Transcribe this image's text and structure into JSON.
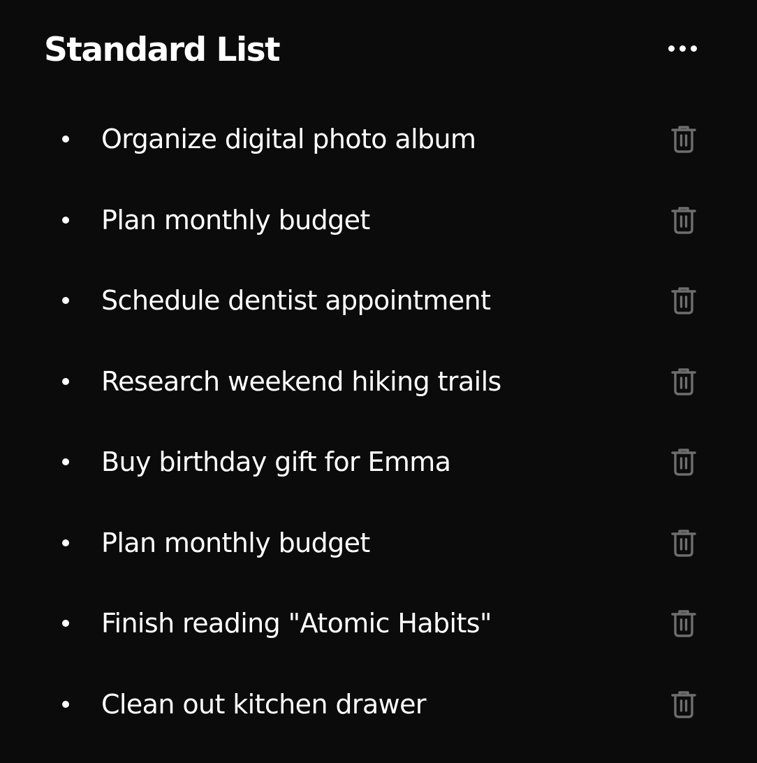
{
  "header": {
    "title": "Standard List",
    "more_icon": "more-horizontal-icon"
  },
  "list": {
    "items": [
      {
        "label": "Organize digital photo album",
        "delete_icon": "trash-icon"
      },
      {
        "label": "Plan monthly budget",
        "delete_icon": "trash-icon"
      },
      {
        "label": "Schedule dentist appointment",
        "delete_icon": "trash-icon"
      },
      {
        "label": "Research weekend hiking trails",
        "delete_icon": "trash-icon"
      },
      {
        "label": "Buy birthday gift for Emma",
        "delete_icon": "trash-icon"
      },
      {
        "label": "Plan monthly budget",
        "delete_icon": "trash-icon"
      },
      {
        "label": "Finish reading \"Atomic Habits\"",
        "delete_icon": "trash-icon"
      },
      {
        "label": "Clean out kitchen drawer",
        "delete_icon": "trash-icon"
      }
    ]
  },
  "colors": {
    "background": "#0b0b0b",
    "text": "#ffffff",
    "icon_muted": "#6e6e6e"
  }
}
